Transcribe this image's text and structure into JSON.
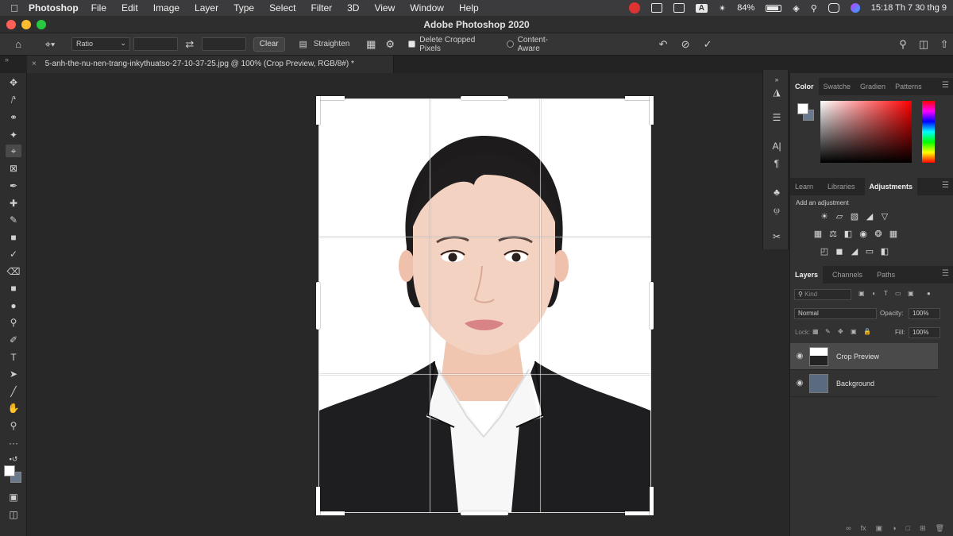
{
  "menubar": {
    "app": "Photoshop",
    "items": [
      "File",
      "Edit",
      "Image",
      "Layer",
      "Type",
      "Select",
      "Filter",
      "3D",
      "View",
      "Window",
      "Help"
    ],
    "battery": "84%",
    "clock": "15:18 Th 7 30 thg 9"
  },
  "window": {
    "title": "Adobe Photoshop 2020"
  },
  "options": {
    "ratio_label": "Ratio",
    "clear_label": "Clear",
    "straighten_label": "Straighten",
    "delete_cropped_label": "Delete Cropped Pixels",
    "content_aware_label": "Content-Aware"
  },
  "document": {
    "tab_title": "5-anh-the-nu-nen-trang-inkythuatso-27-10-37-25.jpg @ 100% (Crop Preview, RGB/8#) *"
  },
  "color_panel": {
    "tabs": [
      "Color",
      "Swatche",
      "Gradien",
      "Patterns"
    ],
    "foreground": "#ffffff",
    "background": "#6a7a8e"
  },
  "adjustments_panel": {
    "tabs": [
      "Learn",
      "Libraries",
      "Adjustments"
    ],
    "hint": "Add an adjustment"
  },
  "layers_panel": {
    "tabs": [
      "Layers",
      "Channels",
      "Paths"
    ],
    "filter_placeholder": "Kind",
    "blend_mode": "Normal",
    "opacity_label": "Opacity:",
    "opacity_value": "100%",
    "lock_label": "Lock:",
    "fill_label": "Fill:",
    "fill_value": "100%",
    "layers": [
      {
        "name": "Crop Preview",
        "selected": true
      },
      {
        "name": "Background",
        "selected": false
      }
    ]
  },
  "colors": {
    "accent_close": "#ff5f57",
    "accent_min": "#febc2e",
    "accent_max": "#28c840"
  }
}
